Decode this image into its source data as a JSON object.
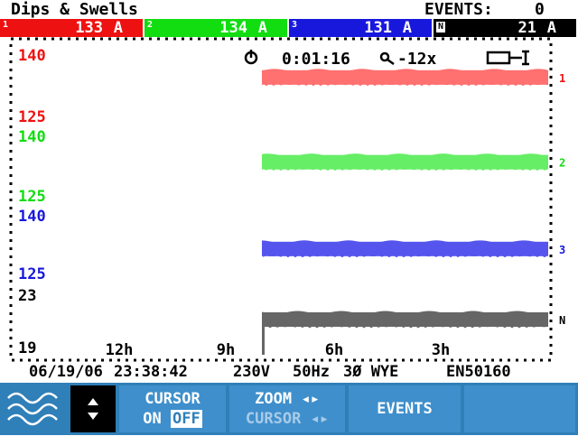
{
  "title": "Dips & Swells",
  "events": {
    "label": "EVENTS:",
    "count": "0"
  },
  "channels": [
    {
      "index": "1",
      "value": "133",
      "unit": "A",
      "color": "#ee1111"
    },
    {
      "index": "2",
      "value": "134",
      "unit": "A",
      "color": "#11dd11"
    },
    {
      "index": "3",
      "value": "131",
      "unit": "A",
      "color": "#1818dd"
    },
    {
      "index": "N",
      "value": "21",
      "unit": "A",
      "color": "#000000"
    }
  ],
  "status": {
    "timer": "0:01:16",
    "zoom": "-12x"
  },
  "info": {
    "date": "06/19/06",
    "time": "23:38:42",
    "voltage": "230V",
    "freq": "50Hz",
    "config": "3Ø WYE",
    "standard": "EN50160"
  },
  "softkeys": {
    "cursor_l1": "CURSOR",
    "cursor_on": "ON",
    "cursor_off": "OFF",
    "zoom_l1": "ZOOM",
    "zoom_l2": "CURSOR",
    "events": "EVENTS"
  },
  "chart_data": {
    "type": "line",
    "x_ticks": [
      "12h",
      "9h",
      "6h",
      "3h"
    ],
    "series": [
      {
        "name": "1",
        "ymax": 140,
        "ymin": 125,
        "level": 134,
        "color": "#ff7070"
      },
      {
        "name": "2",
        "ymax": 140,
        "ymin": 125,
        "level": 133,
        "color": "#66ee66"
      },
      {
        "name": "3",
        "ymax": 140,
        "ymin": 125,
        "level": 131,
        "color": "#5555ee"
      },
      {
        "name": "N",
        "ymax": 23,
        "ymin": 19,
        "level": 21,
        "color": "#666666"
      }
    ]
  }
}
